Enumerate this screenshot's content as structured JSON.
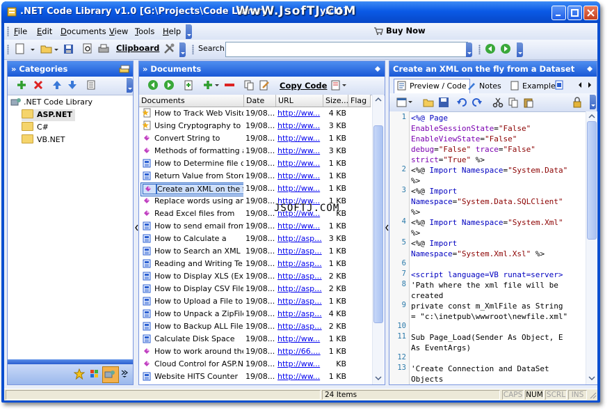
{
  "window": {
    "title": ".NET Code Library v1.0 [G:\\Projects\\Code Library\\",
    "title_tail": "y.cl1]",
    "watermark_top": "WwW.JsofTJ.CoM",
    "watermark_mid": "JSOFTJ.COM"
  },
  "menu": {
    "items": [
      {
        "u": "F",
        "rest": "ile"
      },
      {
        "u": "E",
        "rest": "dit"
      },
      {
        "u": "D",
        "rest": "ocuments"
      },
      {
        "u": "V",
        "rest": "iew"
      },
      {
        "u": "T",
        "rest": "ools"
      },
      {
        "u": "H",
        "rest": "elp"
      }
    ],
    "buy_now": "Buy Now"
  },
  "toolbar": {
    "clipboard_label": "Clipboard",
    "search_label": "Search",
    "search_value": ""
  },
  "categories": {
    "header": "» Categories",
    "root": ".NET Code Library",
    "items": [
      "ASP.NET",
      "C#",
      "VB.NET"
    ]
  },
  "documents": {
    "header": "» Documents",
    "copy_code_label": "Copy Code",
    "columns": [
      "Documents",
      "Date",
      "URL",
      "Size...",
      "Flag"
    ],
    "rows": [
      {
        "name": "How to Track Web Visito...",
        "date": "19/08...",
        "url": "http://ww...",
        "size": "4 KB",
        "icon": "star-doc-icon"
      },
      {
        "name": "Using Cryptography to",
        "date": "19/08...",
        "url": "http://ww...",
        "size": "3 KB",
        "icon": "star-doc-icon"
      },
      {
        "name": "Convert String to",
        "date": "19/08...",
        "url": "http://ww...",
        "size": "1 KB",
        "icon": "diamond-doc-icon"
      },
      {
        "name": "Methods of formatting a...",
        "date": "19/08...",
        "url": "http://ww...",
        "size": "3 KB",
        "icon": "diamond-doc-icon"
      },
      {
        "name": "How to Determine file d...",
        "date": "19/08...",
        "url": "http://ww...",
        "size": "1 KB",
        "icon": "book-doc-icon"
      },
      {
        "name": "Return Value from Store...",
        "date": "19/08...",
        "url": "http://ww...",
        "size": "1 KB",
        "icon": "book-doc-icon"
      },
      {
        "name": "Create an XML on the fly",
        "date": "19/08...",
        "url": "http://ww...",
        "size": "1 KB",
        "icon": "diamond-doc-icon"
      },
      {
        "name": "Replace words using an",
        "date": "19/08...",
        "url": "http://ww...",
        "size": "1 KB",
        "icon": "diamond-doc-icon"
      },
      {
        "name": "Read Excel files from",
        "date": "19/08...",
        "url": "http://ww...",
        "size": "KB",
        "icon": "diamond-doc-icon"
      },
      {
        "name": "How to send email from",
        "date": "19/08...",
        "url": "http://ww...",
        "size": "1 KB",
        "icon": "book-doc-icon"
      },
      {
        "name": "How to Calculate a",
        "date": "19/08...",
        "url": "http://asp...",
        "size": "3 KB",
        "icon": "book-doc-icon"
      },
      {
        "name": "How to Search an XML F...",
        "date": "19/08...",
        "url": "http://asp...",
        "size": "1 KB",
        "icon": "book-doc-icon"
      },
      {
        "name": "Reading and Writing Te...",
        "date": "19/08...",
        "url": "http://asp...",
        "size": "1 KB",
        "icon": "book-doc-icon"
      },
      {
        "name": "How to Display XLS (Exc...",
        "date": "19/08...",
        "url": "http://asp...",
        "size": "2 KB",
        "icon": "book-doc-icon"
      },
      {
        "name": "How to Display CSV File",
        "date": "19/08...",
        "url": "http://asp...",
        "size": "2 KB",
        "icon": "book-doc-icon"
      },
      {
        "name": "How to Upload a File to a",
        "date": "19/08...",
        "url": "http://asp...",
        "size": "1 KB",
        "icon": "book-doc-icon"
      },
      {
        "name": "How to Unpack a ZipFile ...",
        "date": "19/08...",
        "url": "http://asp...",
        "size": "4 KB",
        "icon": "book-doc-icon"
      },
      {
        "name": "How to Backup ALL Files",
        "date": "19/08...",
        "url": "http://asp...",
        "size": "2 KB",
        "icon": "book-doc-icon"
      },
      {
        "name": "Calculate Disk Space",
        "date": "19/08...",
        "url": "http://ww...",
        "size": "1 KB",
        "icon": "book-doc-icon"
      },
      {
        "name": "How to work around the",
        "date": "19/08...",
        "url": "http://66....",
        "size": "1 KB",
        "icon": "diamond-doc-icon"
      },
      {
        "name": "Cloud Control for ASP.N...",
        "date": "19/08...",
        "url": "http://ww...",
        "size": "KB",
        "icon": "diamond-doc-icon"
      },
      {
        "name": "Website HITS Counter",
        "date": "19/08...",
        "url": "http://ww...",
        "size": "1 KB",
        "icon": "book-doc-icon"
      }
    ],
    "selected_index": 6
  },
  "detail": {
    "header": "Create an XML on the fly from a Dataset",
    "tabs": [
      "Preview / Code",
      "Notes",
      "Example"
    ],
    "active_tab": 0
  },
  "code_lines": [
    {
      "n": "1",
      "parts": [
        [
          "k",
          "<%@ Page"
        ]
      ]
    },
    {
      "n": "",
      "parts": [
        [
          "v",
          "EnableSessionState"
        ],
        [
          "t",
          "="
        ],
        [
          "s",
          "\"False\""
        ]
      ]
    },
    {
      "n": "",
      "parts": [
        [
          "v",
          "EnableViewState"
        ],
        [
          "t",
          "="
        ],
        [
          "s",
          "\"False\""
        ]
      ]
    },
    {
      "n": "",
      "parts": [
        [
          "v",
          "debug"
        ],
        [
          "t",
          "="
        ],
        [
          "s",
          "\"False\""
        ],
        [
          "t",
          " "
        ],
        [
          "v",
          "trace"
        ],
        [
          "t",
          "="
        ],
        [
          "s",
          "\"False\""
        ]
      ]
    },
    {
      "n": "",
      "parts": [
        [
          "v",
          "strict"
        ],
        [
          "t",
          "="
        ],
        [
          "s",
          "\"True\""
        ],
        [
          "t",
          " %>"
        ]
      ]
    },
    {
      "n": "2",
      "parts": [
        [
          "t",
          "<%@ "
        ],
        [
          "k",
          "Import Namespace"
        ],
        [
          "t",
          "="
        ],
        [
          "s",
          "\"System.Data\""
        ]
      ]
    },
    {
      "n": "",
      "parts": [
        [
          "t",
          "%>"
        ]
      ]
    },
    {
      "n": "3",
      "parts": [
        [
          "t",
          "<%@ "
        ],
        [
          "k",
          "Import"
        ]
      ]
    },
    {
      "n": "",
      "parts": [
        [
          "k",
          "Namespace"
        ],
        [
          "t",
          "="
        ],
        [
          "s",
          "\"System.Data.SQLClient\""
        ]
      ]
    },
    {
      "n": "",
      "parts": [
        [
          "t",
          "%>"
        ]
      ]
    },
    {
      "n": "4",
      "parts": [
        [
          "t",
          "<%@ "
        ],
        [
          "k",
          "Import Namespace"
        ],
        [
          "t",
          "="
        ],
        [
          "s",
          "\"System.Xml\""
        ]
      ]
    },
    {
      "n": "",
      "parts": [
        [
          "t",
          "%>"
        ]
      ]
    },
    {
      "n": "5",
      "parts": [
        [
          "t",
          "<%@ "
        ],
        [
          "k",
          "Import"
        ]
      ]
    },
    {
      "n": "",
      "parts": [
        [
          "k",
          "Namespace"
        ],
        [
          "t",
          "="
        ],
        [
          "s",
          "\"System.Xml.Xsl\""
        ],
        [
          "t",
          " %>"
        ]
      ]
    },
    {
      "n": "6",
      "parts": [
        [
          "t",
          ""
        ]
      ]
    },
    {
      "n": "7",
      "parts": [
        [
          "k",
          "<script language=VB runat=server>"
        ]
      ]
    },
    {
      "n": "8",
      "parts": [
        [
          "t",
          "'Path where the xml file will be"
        ]
      ]
    },
    {
      "n": "",
      "parts": [
        [
          "t",
          "created"
        ]
      ]
    },
    {
      "n": "9",
      "parts": [
        [
          "t",
          "private const m_XmlFile as String"
        ]
      ]
    },
    {
      "n": "",
      "parts": [
        [
          "t",
          "= \"c:\\inetpub\\wwwroot\\newfile.xml\""
        ]
      ]
    },
    {
      "n": "10",
      "parts": [
        [
          "t",
          ""
        ]
      ]
    },
    {
      "n": "11",
      "parts": [
        [
          "t",
          "Sub Page_Load(Sender As Object, E"
        ]
      ]
    },
    {
      "n": "",
      "parts": [
        [
          "t",
          "As EventArgs)"
        ]
      ]
    },
    {
      "n": "12",
      "parts": [
        [
          "t",
          ""
        ]
      ]
    },
    {
      "n": "13",
      "parts": [
        [
          "t",
          "'Create Connection and DataSet"
        ]
      ]
    },
    {
      "n": "",
      "parts": [
        [
          "t",
          "Objects"
        ]
      ]
    }
  ],
  "status": {
    "items": "24 Items",
    "caps": "CAPS",
    "num": "NUM",
    "scrl": "SCRL",
    "ins": "INS"
  }
}
